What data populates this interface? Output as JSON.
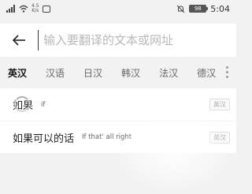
{
  "status_bar": {
    "carrier_left": "☰",
    "network_speed_top": "4.5",
    "network_speed_bottom": "K/s",
    "battery_level": "98",
    "time": "5:04"
  },
  "search": {
    "placeholder": "输入要翻译的文本或网址",
    "value": ""
  },
  "language_tabs": [
    {
      "label": "英汉",
      "active": true
    },
    {
      "label": "汉语",
      "active": false
    },
    {
      "label": "日汉",
      "active": false
    },
    {
      "label": "韩汉",
      "active": false
    },
    {
      "label": "法汉",
      "active": false
    },
    {
      "label": "德汉",
      "active": false
    }
  ],
  "results": [
    {
      "word": "如果",
      "meaning": "if",
      "badge": "英汉"
    },
    {
      "word": "如果可以的话",
      "meaning": "If that' all right",
      "badge": "英汉"
    }
  ],
  "colors": {
    "background": "#f2f2f2",
    "card": "#ffffff",
    "active_tab": "#111111",
    "inactive_tab": "#666666"
  }
}
